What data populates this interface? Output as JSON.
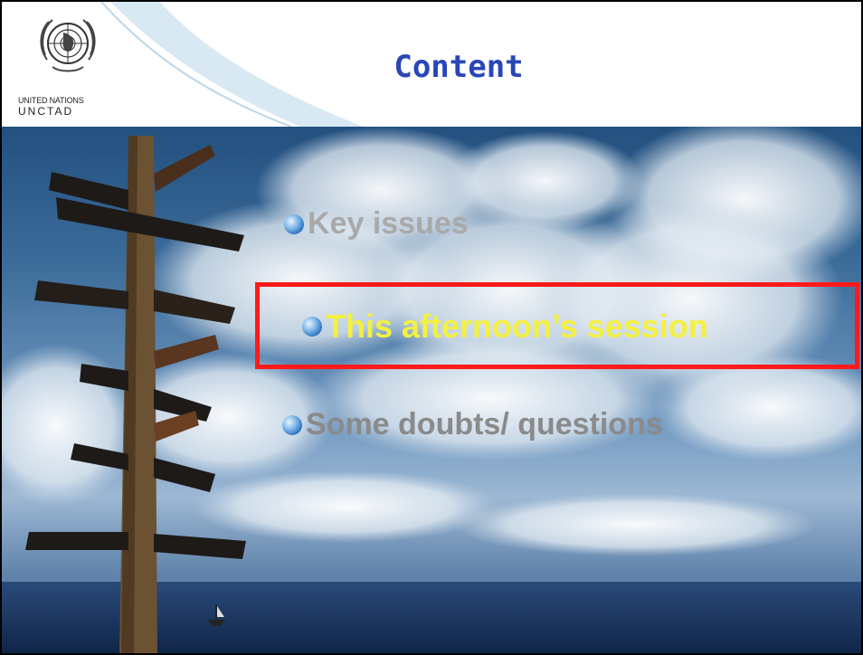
{
  "slide": {
    "title": "Content",
    "logo": {
      "line1": "UNITED NATIONS",
      "line2": "UNCTAD",
      "icon": "un-emblem-icon"
    },
    "items": [
      {
        "label": "Key issues",
        "state": "dimmed"
      },
      {
        "label": "This afternoon’s session",
        "state": "active"
      },
      {
        "label": "Some doubts/ questions",
        "state": "dimmed"
      }
    ],
    "colors": {
      "title": "#2946b8",
      "active_text": "#f4f040",
      "dimmed_text": "#a9a9a9",
      "highlight_border": "#ff1a1a"
    },
    "bullet_icon": "globe-bullet-icon"
  }
}
